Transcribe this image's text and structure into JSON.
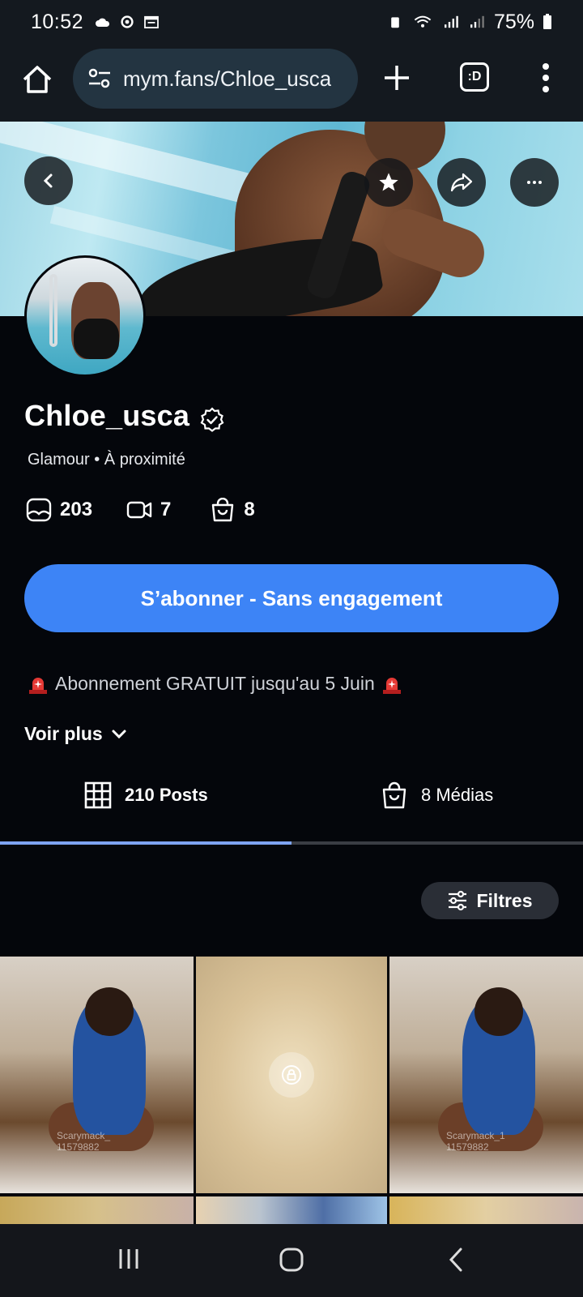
{
  "status_bar": {
    "time": "10:52",
    "battery": "75%"
  },
  "browser": {
    "url": "mym.fans/Chloe_usca",
    "tabs_label": ":D"
  },
  "profile": {
    "name": "Chloe_usca",
    "subtitle": "Glamour • À proximité",
    "stats": {
      "photos": "203",
      "videos": "7",
      "products": "8"
    },
    "subscribe_label": "S’abonner - Sans engagement",
    "promo_text": "Abonnement GRATUIT jusqu'au 5 Juin",
    "see_more_label": "Voir plus"
  },
  "tabs": [
    {
      "label": "210 Posts",
      "active": true
    },
    {
      "label": "8 Médias",
      "active": false
    }
  ],
  "filter_label": "Filtres",
  "grid": {
    "watermark_1": "Scarymack_",
    "watermark_1b": "11579882",
    "watermark_3": "Scarymack_1",
    "watermark_3b": "11579882"
  },
  "colors": {
    "accent": "#3d84f6",
    "background": "#04060b",
    "bar": "#14191f"
  }
}
